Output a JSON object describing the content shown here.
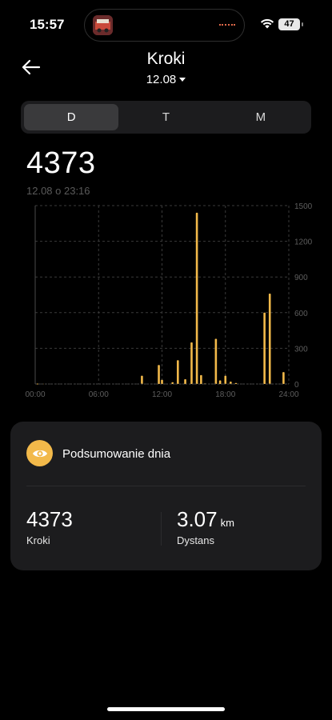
{
  "status_bar": {
    "time": "15:57",
    "battery": "47"
  },
  "header": {
    "title": "Kroki",
    "date": "12.08"
  },
  "period_tabs": [
    {
      "label": "D",
      "active": true
    },
    {
      "label": "T",
      "active": false
    },
    {
      "label": "M",
      "active": false
    }
  ],
  "total": {
    "steps": "4373",
    "timestamp": "12.08 o 23:16"
  },
  "chart_data": {
    "type": "bar",
    "x_unit": "hour",
    "xlim": [
      0,
      24
    ],
    "ylim": [
      0,
      1500
    ],
    "x_ticks": [
      "00:00",
      "06:00",
      "12:00",
      "18:00",
      "24:00"
    ],
    "y_ticks": [
      "1500",
      "1200",
      "900",
      "600",
      "300",
      "0"
    ],
    "bar_color": "#f2b94a",
    "x": [
      0.2,
      0.7,
      10.1,
      11.7,
      12.0,
      13.0,
      13.5,
      14.2,
      14.8,
      15.3,
      15.7,
      16.1,
      17.1,
      17.5,
      18.0,
      18.5,
      19.0,
      21.7,
      22.2,
      23.5
    ],
    "values": [
      3,
      3,
      70,
      160,
      35,
      15,
      200,
      40,
      350,
      1440,
      75,
      5,
      380,
      30,
      70,
      20,
      8,
      600,
      760,
      100
    ]
  },
  "summary": {
    "title": "Podsumowanie dnia",
    "steps_value": "4373",
    "steps_label": "Kroki",
    "distance_value": "3.07",
    "distance_unit": "km",
    "distance_label": "Dystans"
  }
}
